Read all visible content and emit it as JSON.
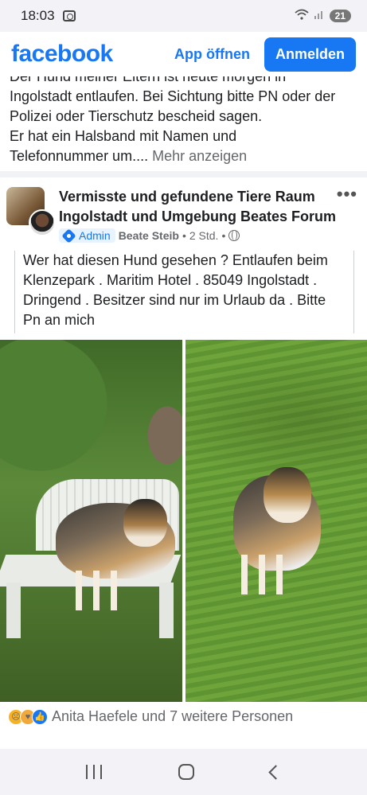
{
  "status": {
    "time": "18:03",
    "battery": "21"
  },
  "header": {
    "logo": "facebook",
    "app_open": "App öffnen",
    "login": "Anmelden"
  },
  "previous_post": {
    "lines": [
      "Der Hund meiner Eltern ist heute morgen in",
      "Ingolstadt entlaufen. Bei Sichtung bitte PN oder der",
      "Polizei oder Tierschutz bescheid sagen.",
      "Er hat ein Halsband mit Namen und",
      "Telefonnummer um.... "
    ],
    "see_more": "Mehr anzeigen"
  },
  "post": {
    "group_name": "Vermisste und gefundene Tiere Raum Ingolstadt  und Umgebung Beates Forum",
    "badge": "Admin",
    "author": "Beate Steib",
    "time": "2 Std.",
    "dot": "•",
    "more": "•••",
    "body": "Wer hat diesen Hund gesehen ? Entlaufen beim Klenzepark . Maritim Hotel . 85049 Ingolstadt . Dringend . Besitzer sind nur im Urlaub da . Bitte Pn an mich"
  },
  "reactions": {
    "icons": [
      "sad-icon",
      "care-icon",
      "like-icon"
    ],
    "text": "Anita Haefele und 7 weitere Personen"
  },
  "colors": {
    "brand": "#1877f2",
    "text": "#1c1e21",
    "secondary": "#65676b"
  }
}
